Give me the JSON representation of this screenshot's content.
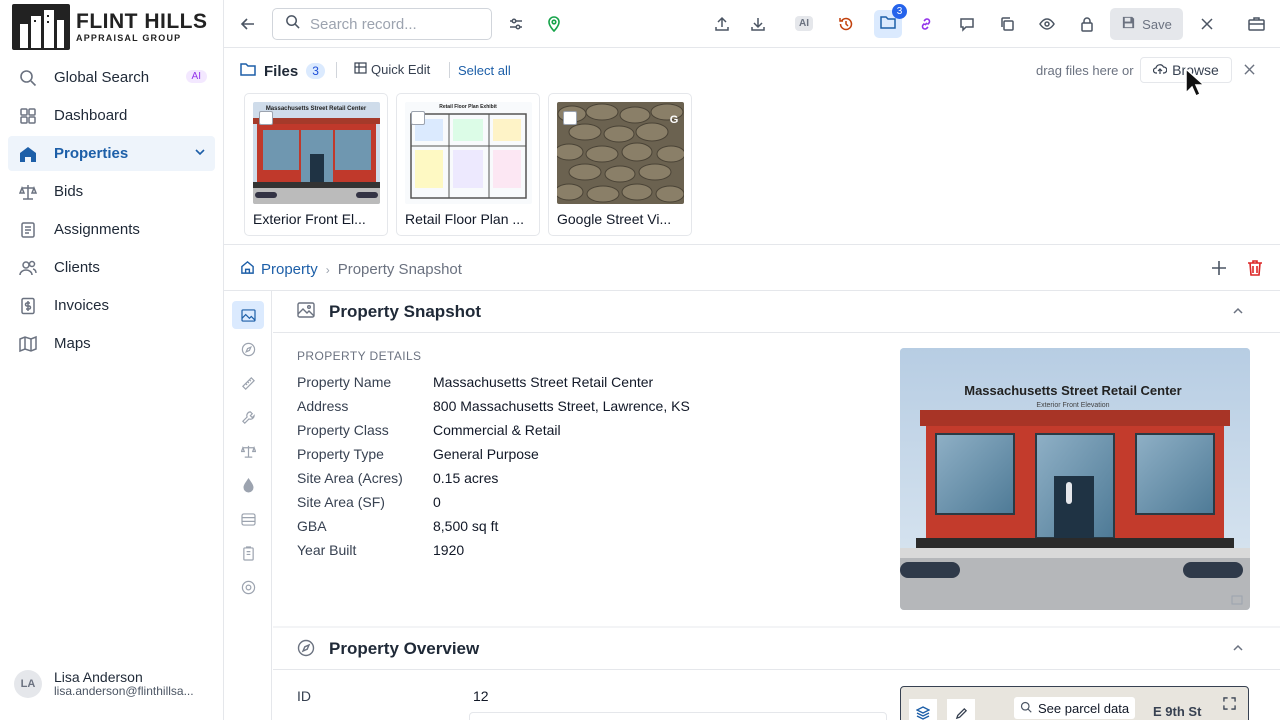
{
  "brand": {
    "title": "FLINT HILLS",
    "subtitle": "APPRAISAL GROUP"
  },
  "sidebar": {
    "items": [
      {
        "label": "Global Search",
        "icon": "search-icon",
        "badge": "AI"
      },
      {
        "label": "Dashboard",
        "icon": "dashboard-icon"
      },
      {
        "label": "Properties",
        "icon": "home-icon",
        "active": true
      },
      {
        "label": "Bids",
        "icon": "scale-icon"
      },
      {
        "label": "Assignments",
        "icon": "clipboard-icon"
      },
      {
        "label": "Clients",
        "icon": "users-icon"
      },
      {
        "label": "Invoices",
        "icon": "invoice-icon"
      },
      {
        "label": "Maps",
        "icon": "map-icon"
      }
    ],
    "user": {
      "initials": "LA",
      "name": "Lisa Anderson",
      "email": "lisa.anderson@flinthillsa..."
    }
  },
  "topbar": {
    "search_placeholder": "Search record...",
    "ai_label": "AI",
    "files_badge": "3",
    "save_label": "Save"
  },
  "files": {
    "title": "Files",
    "count": "3",
    "quick_edit": "Quick Edit",
    "select_all": "Select all",
    "drag_text": "drag files here or",
    "browse": "Browse",
    "thumbs": [
      {
        "label": "Exterior Front El...",
        "image_title": "Massachusetts Street Retail Center"
      },
      {
        "label": "Retail Floor Plan ...",
        "image_title": "Retail Floor Plan Exhibit"
      },
      {
        "label": "Google Street Vi..."
      }
    ]
  },
  "breadcrumb": {
    "root": "Property",
    "current": "Property Snapshot"
  },
  "snapshot": {
    "title": "Property Snapshot",
    "section_label": "PROPERTY DETAILS",
    "details": [
      {
        "key": "Property Name",
        "value": "Massachusetts Street Retail Center"
      },
      {
        "key": "Address",
        "value": "800 Massachusetts Street, Lawrence, KS"
      },
      {
        "key": "Property Class",
        "value": "Commercial & Retail"
      },
      {
        "key": "Property Type",
        "value": "General Purpose"
      },
      {
        "key": "Site Area (Acres)",
        "value": "0.15 acres"
      },
      {
        "key": "Site Area (SF)",
        "value": "0"
      },
      {
        "key": "GBA",
        "value": "8,500 sq ft"
      },
      {
        "key": "Year Built",
        "value": "1920"
      }
    ],
    "image_title": "Massachusetts Street Retail Center",
    "image_subtitle": "Exterior Front Elevation"
  },
  "overview": {
    "title": "Property Overview",
    "id_label": "ID",
    "id_value": "12",
    "map": {
      "parcel_label": "See parcel data",
      "street": "E 9th St"
    }
  },
  "colors": {
    "accent": "#1d5fa8",
    "active_bg": "#eef4fb",
    "danger": "#dc2626"
  }
}
